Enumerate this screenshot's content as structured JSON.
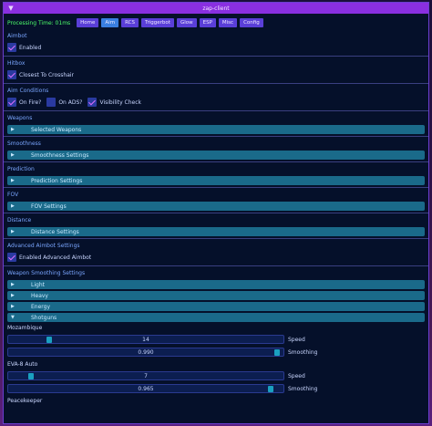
{
  "window": {
    "title": "zap-client"
  },
  "topbar": {
    "processing": "Processing Time: 01ms",
    "tabs": [
      {
        "label": "Home"
      },
      {
        "label": "Aim"
      },
      {
        "label": "RCS"
      },
      {
        "label": "Triggerbot"
      },
      {
        "label": "Glow"
      },
      {
        "label": "ESP"
      },
      {
        "label": "Misc"
      },
      {
        "label": "Config"
      }
    ]
  },
  "aimbot": {
    "title": "Aimbot",
    "enabled_label": "Enabled"
  },
  "hitbox": {
    "title": "Hitbox",
    "closest_label": "Closest To Crosshair"
  },
  "aim_conditions": {
    "title": "Aim Conditions",
    "on_fire": "On Fire?",
    "on_ads": "On ADS?",
    "visibility": "Visibility Check"
  },
  "weapons": {
    "title": "Weapons",
    "header": "Selected Weapons"
  },
  "smoothness": {
    "title": "Smoothness",
    "header": "Smoothness Settings"
  },
  "prediction": {
    "title": "Prediction",
    "header": "Prediction Settings"
  },
  "fov": {
    "title": "FOV",
    "header": "FOV Settings"
  },
  "distance": {
    "title": "Distance",
    "header": "Distance Settings"
  },
  "advanced": {
    "title": "Advanced Aimbot Settings",
    "enabled_label": "Enabled Advanced Aimbot"
  },
  "weapon_smoothing": {
    "title": "Weapon Smoothing Settings",
    "groups": [
      {
        "label": "Light"
      },
      {
        "label": "Heavy"
      },
      {
        "label": "Energy"
      },
      {
        "label": "Shotguns"
      }
    ],
    "weapons": [
      {
        "name": "Mozambique",
        "speed_value": "14",
        "speed_fraction": 0.14,
        "speed_label": "Speed",
        "smoothing_value": "0.990",
        "smoothing_fraction": 0.99,
        "smoothing_label": "Smoothing"
      },
      {
        "name": "EVA-8 Auto",
        "speed_value": "7",
        "speed_fraction": 0.07,
        "speed_label": "Speed",
        "smoothing_value": "0.965",
        "smoothing_fraction": 0.965,
        "smoothing_label": "Smoothing"
      }
    ],
    "next_weapon": "Peacekeeper"
  }
}
